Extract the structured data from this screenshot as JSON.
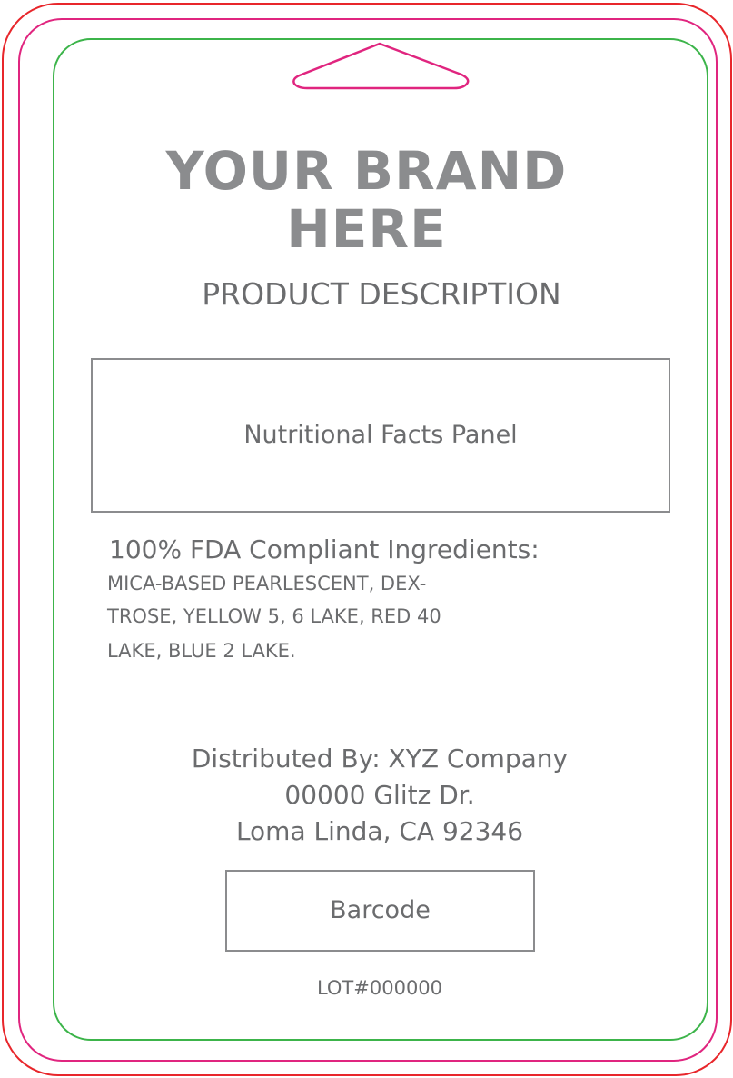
{
  "label": {
    "brand_line1": "YOUR BRAND",
    "brand_line2": "HERE",
    "product_description": "PRODUCT DESCRIPTION",
    "nutrition_panel": "Nutritional Facts Panel",
    "ingredients_title": "100% FDA Compliant Ingredients:",
    "ingredients_lines": [
      "MICA-BASED PEARLESCENT, DEX-",
      "TROSE, YELLOW 5, 6 LAKE, RED 40",
      "LAKE, BLUE 2 LAKE."
    ],
    "distributor_lines": [
      "Distributed By: XYZ Company",
      "00000 Glitz Dr.",
      "Loma Linda, CA 92346"
    ],
    "barcode": "Barcode",
    "lot": "LOT#000000"
  },
  "colors": {
    "bleed_line": "#e8262b",
    "trim_line": "#e0257f",
    "safe_line": "#3cb44a",
    "brand_text": "#8b8c8e",
    "body_text": "#6b6c6e"
  },
  "icons": {
    "hang_hole": "hang-hole-icon"
  }
}
